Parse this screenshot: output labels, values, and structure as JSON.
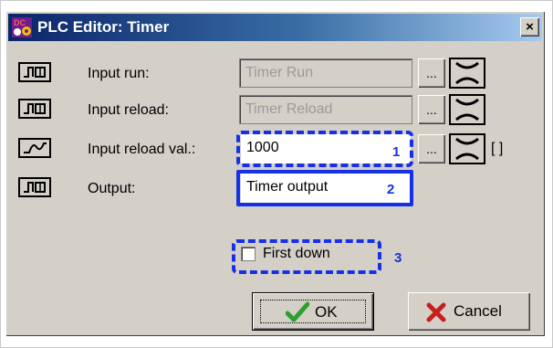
{
  "window": {
    "title": "PLC Editor: Timer",
    "close_label": "×",
    "app_icon": "plc-app-icon"
  },
  "rows": [
    {
      "icon": "digital-input-icon",
      "label": "Input run:",
      "value": "Timer Run",
      "ellipsis": "...",
      "clear_icon": "clear-link-icon"
    },
    {
      "icon": "digital-input-icon",
      "label": "Input reload:",
      "value": "Timer Reload",
      "ellipsis": "...",
      "clear_icon": "clear-link-icon"
    },
    {
      "icon": "analog-input-icon",
      "label": "Input reload val.:",
      "value": "1000",
      "ellipsis": "...",
      "clear_icon": "clear-link-icon",
      "suffix": "[ ]"
    },
    {
      "icon": "digital-output-icon",
      "label": "Output:",
      "value": "Timer output"
    }
  ],
  "checkbox": {
    "label": "First down",
    "checked": false
  },
  "callouts": {
    "one": "1",
    "two": "2",
    "three": "3"
  },
  "buttons": {
    "ok": "OK",
    "cancel": "Cancel"
  },
  "colors": {
    "highlight": "#1530e6",
    "titlebar_start": "#0a246a",
    "titlebar_end": "#a6caf0",
    "ok_check": "#2e9e2e",
    "cancel_x": "#c81e1e"
  }
}
